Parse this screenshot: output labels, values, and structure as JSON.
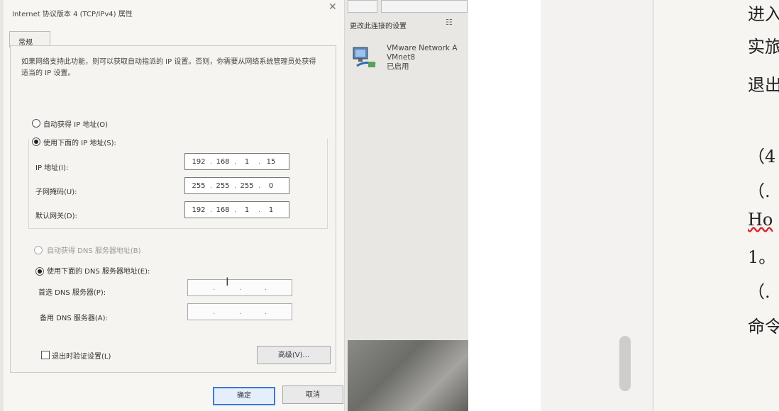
{
  "background_window": {
    "connection_settings_label": "更改此连接的设置",
    "adapter": {
      "name": "VMware Network A",
      "device": "VMnet8",
      "status": "已启用"
    }
  },
  "dialog": {
    "title": "Internet 协议版本 4 (TCP/IPv4) 属性",
    "tab": "常规",
    "description": "如果网络支持此功能，则可以获取自动指派的 IP 设置。否则，你需要从网络系统管理员处获得适当的 IP 设置。",
    "auto_ip_label": "自动获得 IP 地址(O)",
    "manual_ip_label": "使用下面的 IP 地址(S):",
    "ip": {
      "label": "IP 地址(I):",
      "octets": [
        "192",
        "168",
        "1",
        "15"
      ]
    },
    "subnet": {
      "label": "子网掩码(U):",
      "octets": [
        "255",
        "255",
        "255",
        "0"
      ]
    },
    "gateway": {
      "label": "默认网关(D):",
      "octets": [
        "192",
        "168",
        "1",
        "1"
      ]
    },
    "auto_dns_label": "自动获得 DNS 服务器地址(B)",
    "manual_dns_label": "使用下面的 DNS 服务器地址(E):",
    "preferred_dns_label": "首选 DNS 服务器(P):",
    "alternate_dns_label": "备用 DNS 服务器(A):",
    "validate_label": "退出时验证设置(L)",
    "advanced_button": "高级(V)...",
    "ok_button": "确定",
    "cancel_button": "取消"
  },
  "document": {
    "lines": [
      "进入",
      "实旅",
      "退出",
      "（4",
      "（.",
      "Ho",
      "1。",
      "（.",
      "命令"
    ]
  }
}
